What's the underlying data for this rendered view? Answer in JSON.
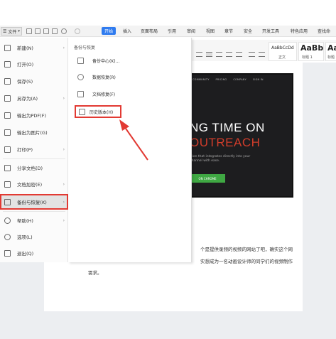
{
  "toolbar": {
    "file_label": "文件",
    "tabs": [
      "开始",
      "插入",
      "页面布局",
      "引用",
      "审阅",
      "视图",
      "章节",
      "安全",
      "开发工具",
      "特色应用",
      "查找命"
    ]
  },
  "styles": [
    {
      "sample": "AaBbCcDd",
      "name": "正文"
    },
    {
      "sample": "AaBb",
      "name": "标题 1"
    },
    {
      "sample": "AaBb",
      "name": "标题"
    }
  ],
  "file_menu": {
    "items": [
      {
        "label": "新建(N)",
        "icon": "new-doc-icon",
        "arrow": "›"
      },
      {
        "label": "打开(O)",
        "icon": "folder-open-icon",
        "arrow": ""
      },
      {
        "label": "保存(S)",
        "icon": "save-icon",
        "arrow": ""
      },
      {
        "label": "另存为(A)",
        "icon": "save-as-icon",
        "arrow": "›"
      },
      {
        "label": "输出为PDF(F)",
        "icon": "pdf-icon",
        "arrow": ""
      },
      {
        "label": "输出为图片(G)",
        "icon": "image-icon",
        "arrow": ""
      },
      {
        "label": "打印(P)",
        "icon": "print-icon",
        "arrow": "›"
      },
      {
        "label": "分享文档(D)",
        "icon": "share-icon",
        "arrow": ""
      },
      {
        "label": "文档加密(E)",
        "icon": "lock-icon",
        "arrow": "›"
      },
      {
        "label": "备份与恢复(K)",
        "icon": "backup-icon",
        "arrow": "›",
        "selected": true
      },
      {
        "label": "帮助(H)",
        "icon": "help-icon",
        "arrow": "›"
      },
      {
        "label": "选项(L)",
        "icon": "settings-icon",
        "arrow": ""
      },
      {
        "label": "退出(Q)",
        "icon": "exit-icon",
        "arrow": ""
      }
    ]
  },
  "submenu": {
    "title": "备份与恢复",
    "items": [
      {
        "label": "备份中心(K)...",
        "icon": "backup-center-icon"
      },
      {
        "label": "数据恢复(R)",
        "icon": "data-recovery-icon"
      },
      {
        "label": "文档修复(F)",
        "icon": "doc-repair-icon"
      },
      {
        "label": "历史版本(H)",
        "icon": "history-icon"
      }
    ]
  },
  "video": {
    "nav": [
      "COMMUNITY",
      "PRICING",
      "COMPANY",
      "SIGN IN"
    ],
    "title_line1": "NG TIME ON",
    "title_line2": "OUTREACH",
    "subtitle": "rtion that integrates directly into your channel with ease.",
    "cta": "ON CHROME"
  },
  "document": {
    "line1": "个是提供录频的视频的网站了吧，确实这个网",
    "line2": "实想成为一名动画设计师的同学们的视频制作",
    "line3": "需求。"
  },
  "colors": {
    "accent_blue": "#2f7bef",
    "highlight_red": "#e23a33",
    "video_red": "#d13d2b",
    "cta_green": "#3fa843"
  }
}
